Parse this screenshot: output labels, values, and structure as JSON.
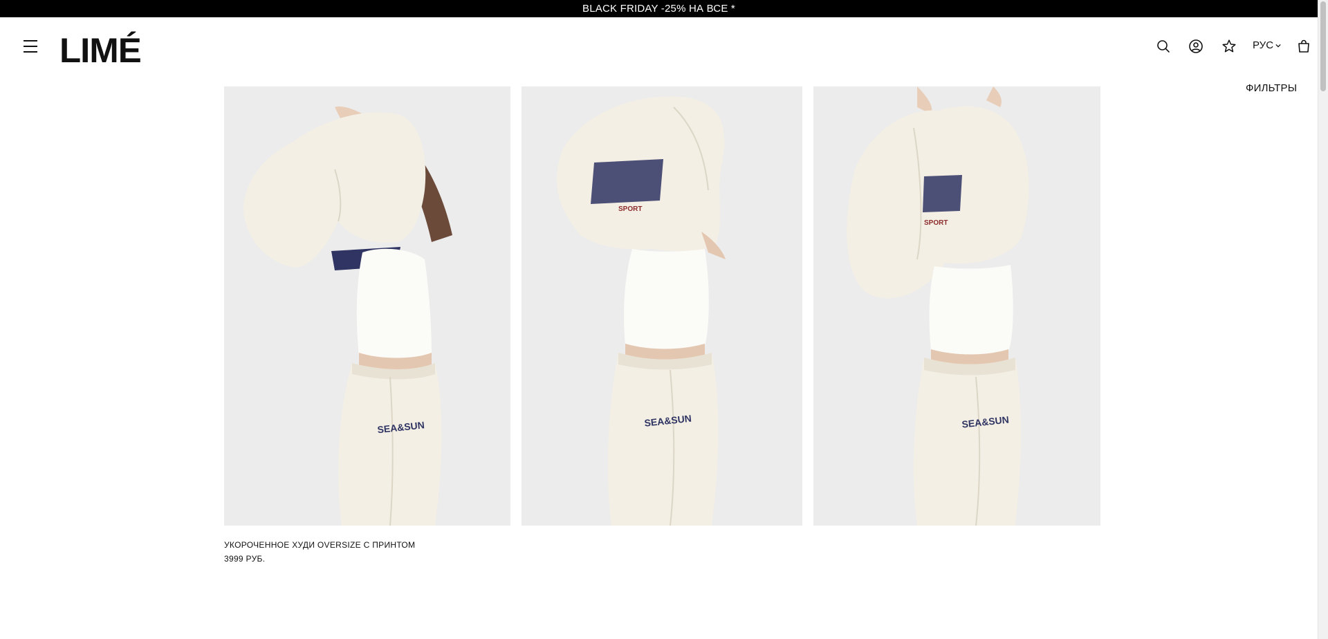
{
  "promo": {
    "text": "BLACK FRIDAY -25% НА ВСЕ *"
  },
  "header": {
    "logo_text": "LIMÉ",
    "menu_icon": "menu-icon",
    "icons": [
      "search-icon",
      "account-icon",
      "favorites-star-icon",
      "cart-bag-icon"
    ],
    "language": "РУС",
    "language_caret": "chevron-down-icon"
  },
  "filters": {
    "label": "ФИЛЬТРЫ"
  },
  "product": {
    "name": "УКОРОЧЕННОЕ ХУДИ OVERSIZE С ПРИНТОМ",
    "price": "3999 РУБ.",
    "photos": [
      {
        "alt": "Cropped hoodie photo, model pulling hood over head, side view"
      },
      {
        "alt": "Cropped hoodie photo, back print SEA&SUN"
      },
      {
        "alt": "Cropped hoodie photo, three-quarter view"
      }
    ],
    "print_text": "SEA&SUN"
  },
  "colors": {
    "promo_bg": "#000000",
    "photo_bg": "#ececec",
    "garment": "#f3efe4",
    "print_navy": "#2f3463"
  }
}
